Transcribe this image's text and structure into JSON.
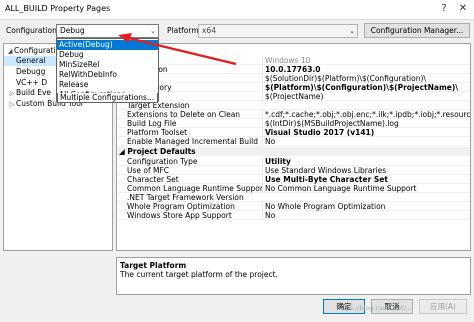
{
  "window": {
    "title": "ALL_BUILD Property Pages",
    "help_label": "?",
    "close_label": "✕"
  },
  "toolbar": {
    "configuration_label": "Configuration:",
    "configuration_value": "Debug",
    "platform_label": "Platform:",
    "platform_value": "x64",
    "config_manager_label": "Configuration Manager..."
  },
  "config_dropdown": {
    "options": [
      "Active(Debug)",
      "Debug",
      "MinSizeRel",
      "RelWithDebInfo",
      "Release",
      "All Configurations",
      "Multiple Configurations..."
    ],
    "selected_index": 0
  },
  "tree": {
    "items": [
      {
        "label": "Configuratio",
        "toggle": "◢",
        "selected": false
      },
      {
        "label": "General",
        "toggle": "",
        "selected": true
      },
      {
        "label": "Debugg",
        "toggle": "",
        "selected": false
      },
      {
        "label": "VC++ D",
        "toggle": "",
        "selected": false
      },
      {
        "label": "Build Eve",
        "toggle": "▷",
        "selected": false
      },
      {
        "label": "Custom Build Tool",
        "toggle": "▷",
        "selected": false
      }
    ]
  },
  "grid": {
    "rows": [
      {
        "type": "row",
        "key": "",
        "value": "Windows 10",
        "value_style": "g"
      },
      {
        "type": "row",
        "key": "DK Version",
        "value": "10.0.17763.0",
        "value_style": "b"
      },
      {
        "type": "row",
        "key": "rectory",
        "value": "$(SolutionDir)$(Platform)\\$(Configuration)\\",
        "value_style": ""
      },
      {
        "type": "row",
        "key": "te Directory",
        "value": "$(Platform)\\$(Configuration)\\$(ProjectName)\\",
        "value_style": "b"
      },
      {
        "type": "row",
        "key": "",
        "value": "$(ProjectName)",
        "value_style": ""
      },
      {
        "type": "row",
        "key": "Target Extension",
        "value": "",
        "value_style": ""
      },
      {
        "type": "row",
        "key": "Extensions to Delete on Clean",
        "value": "*.cdf;*.cache;*.obj;*.obj.enc;*.ilk;*.ipdb;*.iobj;*.resources;*.tlb;*.tli;",
        "value_style": ""
      },
      {
        "type": "row",
        "key": "Build Log File",
        "value": "$(IntDir)$(MSBuildProjectName).log",
        "value_style": ""
      },
      {
        "type": "row",
        "key": "Platform Toolset",
        "value": "Visual Studio 2017 (v141)",
        "value_style": "b"
      },
      {
        "type": "row",
        "key": "Enable Managed Incremental Build",
        "value": "No",
        "value_style": ""
      },
      {
        "type": "sec",
        "key": "Project Defaults",
        "value": "",
        "value_style": ""
      },
      {
        "type": "row",
        "key": "Configuration Type",
        "value": "Utility",
        "value_style": "b"
      },
      {
        "type": "row",
        "key": "Use of MFC",
        "value": "Use Standard Windows Libraries",
        "value_style": ""
      },
      {
        "type": "row",
        "key": "Character Set",
        "value": "Use Multi-Byte Character Set",
        "value_style": "b"
      },
      {
        "type": "row",
        "key": "Common Language Runtime Support",
        "value": "No Common Language Runtime Support",
        "value_style": ""
      },
      {
        "type": "row",
        "key": ".NET Target Framework Version",
        "value": "",
        "value_style": ""
      },
      {
        "type": "row",
        "key": "Whole Program Optimization",
        "value": "No Whole Program Optimization",
        "value_style": ""
      },
      {
        "type": "row",
        "key": "Windows Store App Support",
        "value": "No",
        "value_style": ""
      }
    ]
  },
  "description": {
    "title": "Target Platform",
    "text": "The current target platform of the project."
  },
  "footer": {
    "ok_label": "确定",
    "cancel_label": "取消",
    "apply_label": "应用(A)"
  },
  "watermark": "https://blog.csdn.net/...",
  "colors": {
    "selection": "#0078d7",
    "annotation_arrow": "#e02020"
  }
}
